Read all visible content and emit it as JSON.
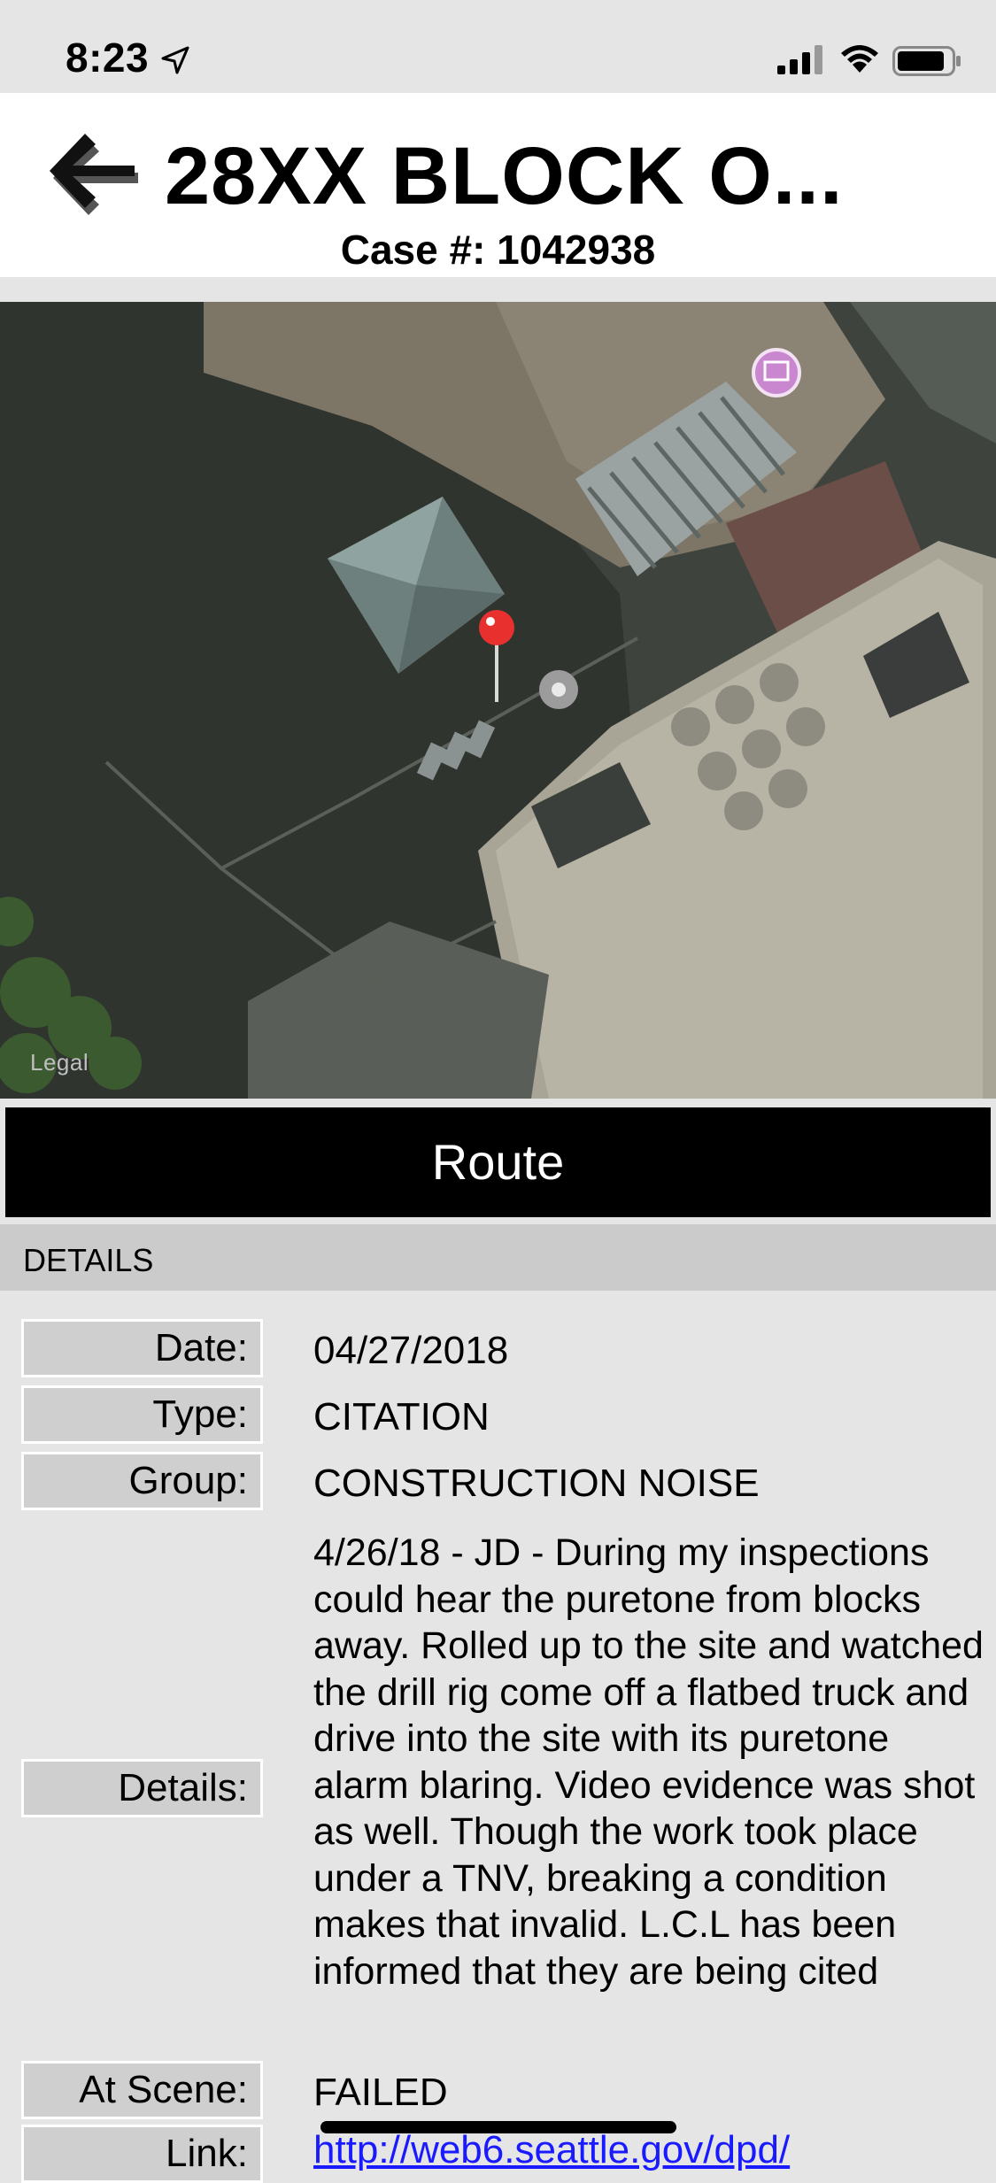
{
  "status_bar": {
    "time": "8:23"
  },
  "header": {
    "title": "28XX BLOCK O...",
    "case_number": "Case #: 1042938"
  },
  "map": {
    "legal_label": "Legal"
  },
  "route_button": {
    "label": "Route"
  },
  "details": {
    "section_title": "DETAILS",
    "rows": [
      {
        "label": "Date:",
        "value": "04/27/2018"
      },
      {
        "label": "Type:",
        "value": "CITATION"
      },
      {
        "label": "Group:",
        "value": "CONSTRUCTION NOISE"
      },
      {
        "label": "Details:",
        "value": "4/26/18 - JD - During my inspections could hear the puretone from blocks away. Rolled up to the site and watched the drill rig come off a flatbed truck and drive into the site with its puretone alarm blaring. Video evidence was shot as well. Though the work took place under a TNV, breaking a condition makes that invalid. L.C.L has been informed that they are being cited"
      },
      {
        "label": "At Scene:",
        "value": "FAILED"
      },
      {
        "label": "Link:",
        "value": "http://web6.seattle.gov/dpd/"
      }
    ]
  },
  "colors": {
    "route_bg": "#000000",
    "pin": "#e8312f",
    "link": "#1a1aff"
  }
}
